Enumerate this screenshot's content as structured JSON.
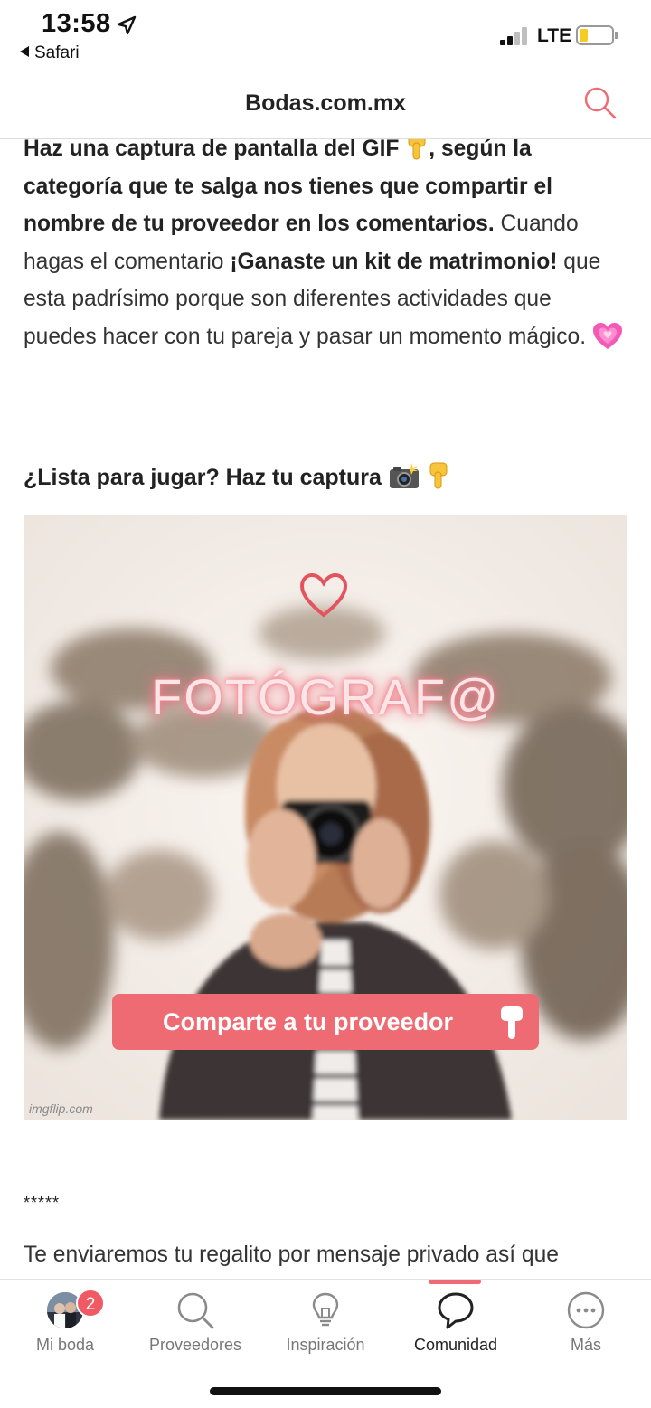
{
  "status_bar": {
    "time": "13:58",
    "back_app": "Safari",
    "network": "LTE",
    "signal_bars": 2,
    "battery_level": 0.2,
    "battery_color": "#f5cc1f"
  },
  "header": {
    "title": "Bodas.com.mx",
    "search_icon": "search-icon"
  },
  "article": {
    "paragraph1": {
      "bold_part1": "Haz una captura de pantalla del GIF",
      "bold_part2": ", según la categoría que te salga nos tienes que compartir el nombre de tu proveedor en los comentarios.",
      "normal_part1": " Cuando hagas el comentario ",
      "bold_part3": "¡Ganaste un kit de matrimonio!",
      "normal_part2": " que esta padrísimo porque son diferentes actividades que puedes hacer con tu pareja y pasar un momento mágico."
    },
    "lead_text": "¿Lista para jugar? Haz tu captura",
    "gif": {
      "title": "FOTÓGRAF@",
      "cta": "Comparte a tu proveedor",
      "watermark": "imgflip.com"
    },
    "separator": "*****",
    "paragraph2": "Te enviaremos tu regalito por mensaje privado así que"
  },
  "tabbar": {
    "tabs": [
      {
        "label": "Mi boda",
        "icon": "avatar",
        "badge": "2"
      },
      {
        "label": "Proveedores",
        "icon": "search-icon"
      },
      {
        "label": "Inspiración",
        "icon": "lightbulb-icon"
      },
      {
        "label": "Comunidad",
        "icon": "chat-bubble-icon",
        "active": true
      },
      {
        "label": "Más",
        "icon": "more-icon"
      }
    ]
  },
  "colors": {
    "accent": "#ef6b73",
    "text": "#333333"
  }
}
